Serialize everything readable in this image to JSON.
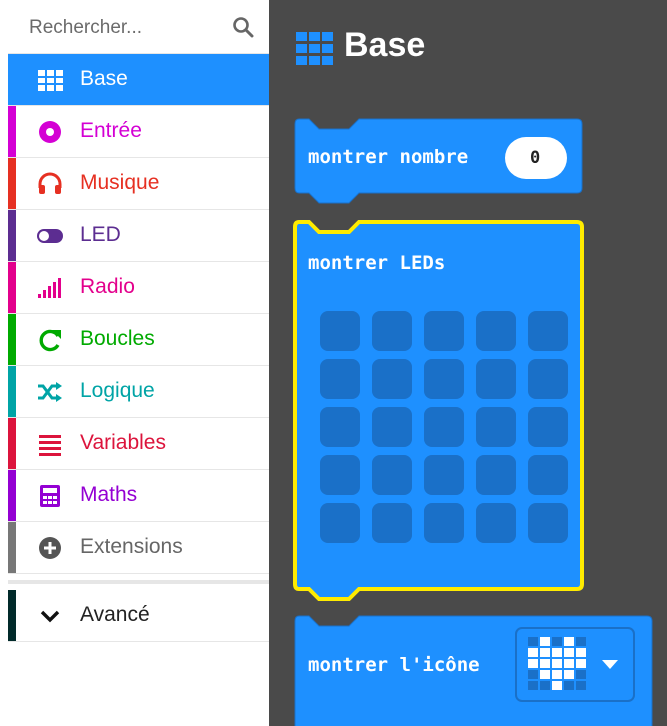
{
  "search": {
    "placeholder": "Rechercher..."
  },
  "categories": [
    {
      "label": "Base",
      "color": "#1e90ff",
      "icon": "grid-icon",
      "selected": true
    },
    {
      "label": "Entrée",
      "color": "#d400d4",
      "icon": "input-circle-icon"
    },
    {
      "label": "Musique",
      "color": "#e63022",
      "icon": "headphones-icon"
    },
    {
      "label": "LED",
      "color": "#5c2d91",
      "icon": "toggle-icon"
    },
    {
      "label": "Radio",
      "color": "#e3008c",
      "icon": "signal-bars-icon"
    },
    {
      "label": "Boucles",
      "color": "#00aa00",
      "icon": "refresh-icon"
    },
    {
      "label": "Logique",
      "color": "#00a4a6",
      "icon": "shuffle-icon"
    },
    {
      "label": "Variables",
      "color": "#dc143c",
      "icon": "list-lines-icon"
    },
    {
      "label": "Maths",
      "color": "#9400d3",
      "icon": "calculator-icon"
    },
    {
      "label": "Extensions",
      "color": "#777777",
      "icon": "plus-circle-icon"
    }
  ],
  "advanced": {
    "label": "Avancé",
    "color": "#012a2a",
    "icon": "chevron-down-icon"
  },
  "flyout": {
    "title": "Base",
    "blocks": [
      {
        "text": "montrer nombre",
        "value": "0"
      },
      {
        "text": "montrer LEDs"
      },
      {
        "text": "montrer l'icône",
        "dropdown_icon": "heart-icon"
      }
    ]
  },
  "colors": {
    "block": "#1e90ff",
    "block_dark": "#1a70c8",
    "highlight": "#ffeb00",
    "workspace": "#4a4a4a"
  }
}
